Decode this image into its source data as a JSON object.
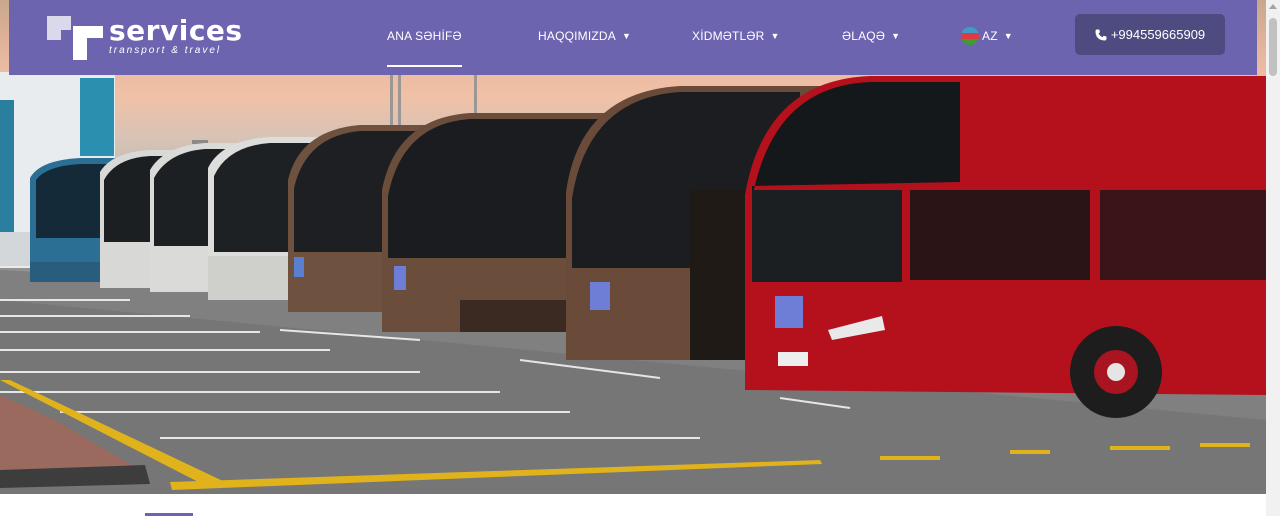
{
  "brand": {
    "name": "services",
    "tagline": "transport & travel"
  },
  "nav": {
    "items": [
      {
        "label": "ANA SƏHİFƏ",
        "active": true,
        "has_dropdown": false
      },
      {
        "label": "HAQQIMIZDA",
        "active": false,
        "has_dropdown": true
      },
      {
        "label": "XİDMƏTLƏR",
        "active": false,
        "has_dropdown": true
      },
      {
        "label": "ƏLAQƏ",
        "active": false,
        "has_dropdown": true
      }
    ],
    "language": {
      "code": "AZ",
      "flag": "azerbaijan-flag-icon"
    },
    "phone": {
      "label": "+994559665909",
      "icon": "phone-icon"
    }
  },
  "hero": {
    "image": "row-of-parked-coaches-photo"
  },
  "colors": {
    "navbar": "#6d64b0",
    "phone_button": "#4e4b80",
    "bus_red": "#b4111d",
    "bus_bronze": "#6f5140",
    "bus_silver": "#d8d8d6",
    "bus_blue": "#2b6f95"
  }
}
